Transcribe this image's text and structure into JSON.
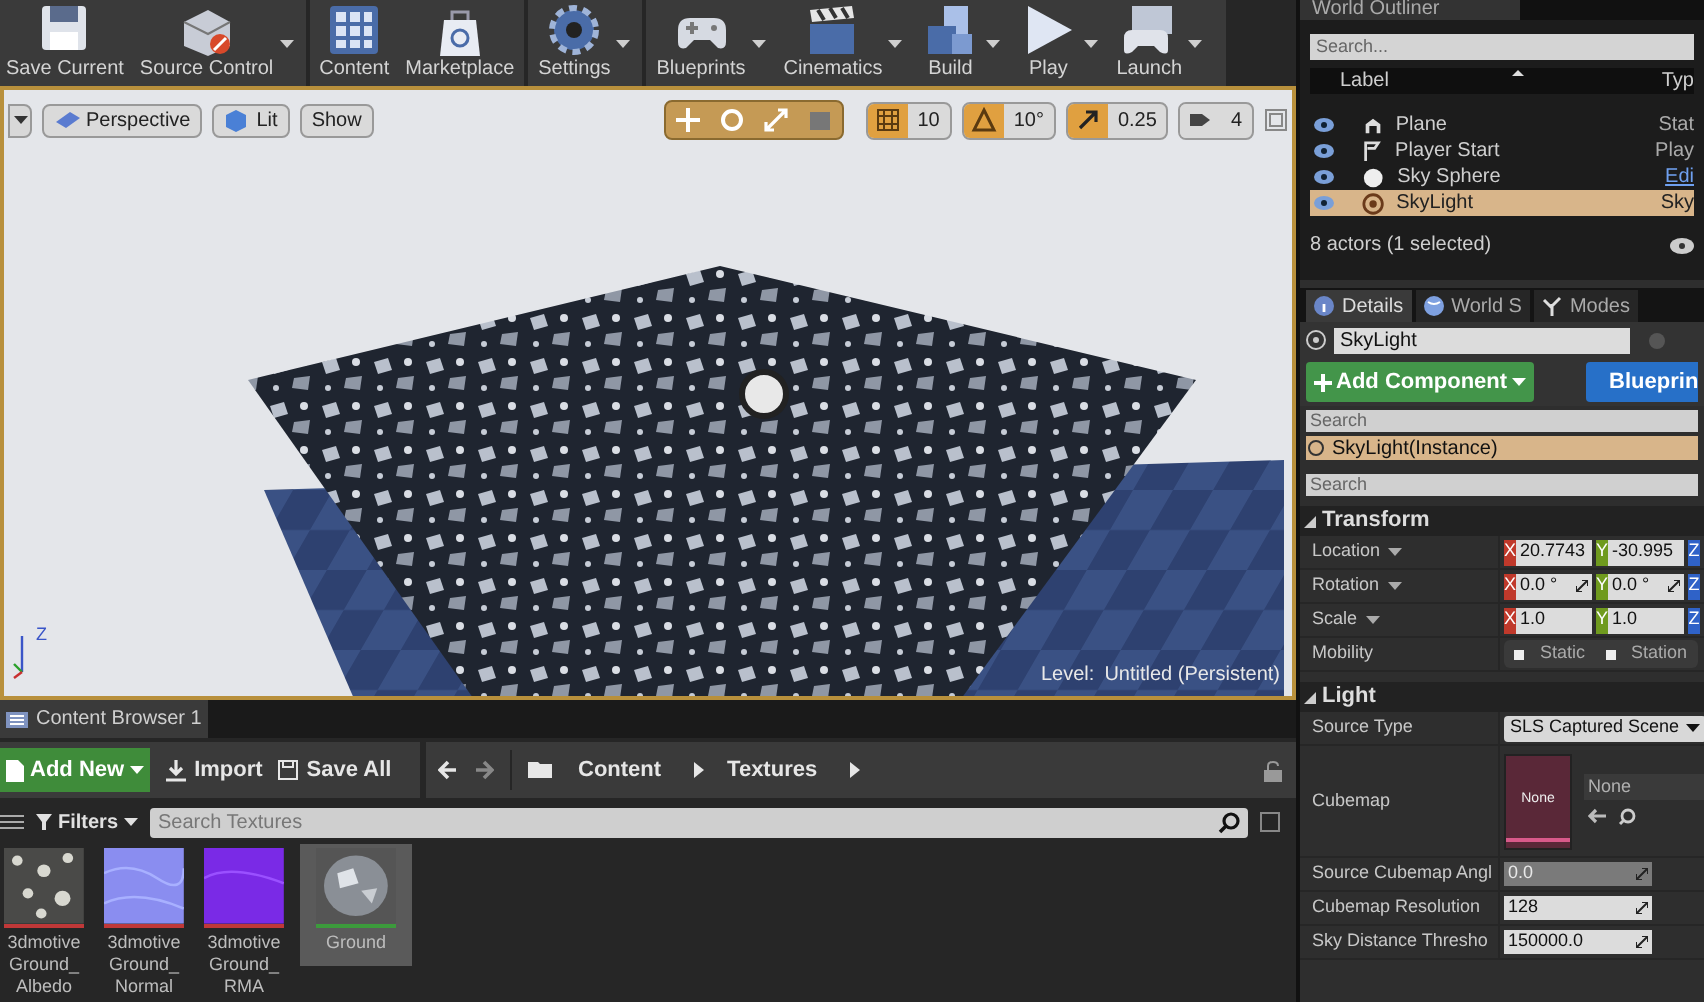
{
  "toolbar": {
    "buttons": [
      {
        "label": "Save Current",
        "dropdown": false
      },
      {
        "label": "Source Control",
        "dropdown": true
      },
      {
        "label": "Content",
        "dropdown": false
      },
      {
        "label": "Marketplace",
        "dropdown": false
      },
      {
        "label": "Settings",
        "dropdown": true
      },
      {
        "label": "Blueprints",
        "dropdown": true
      },
      {
        "label": "Cinematics",
        "dropdown": true
      },
      {
        "label": "Build",
        "dropdown": true
      },
      {
        "label": "Play",
        "dropdown": true
      },
      {
        "label": "Launch",
        "dropdown": true
      }
    ]
  },
  "viewport": {
    "view_buttons": [
      "Perspective",
      "Lit",
      "Show"
    ],
    "snaps": [
      {
        "value": "10",
        "active": true
      },
      {
        "value": "10°",
        "active": true
      },
      {
        "value": "0.25",
        "active": true
      },
      {
        "value": "4",
        "active": false
      }
    ],
    "axis_label": "Z",
    "level_label": "Level:",
    "level_name": "Untitled (Persistent)"
  },
  "world_outliner": {
    "title": "World Outliner",
    "search_placeholder": "Search...",
    "columns": [
      "Label",
      "Typ"
    ],
    "rows": [
      {
        "label": "Plane",
        "type": "Stat",
        "type_is_link": false,
        "visible": true,
        "selected": false
      },
      {
        "label": "Player Start",
        "type": "Play",
        "type_is_link": false,
        "visible": true,
        "selected": false
      },
      {
        "label": "Sky Sphere",
        "type": "Edi",
        "type_is_link": true,
        "visible": true,
        "selected": false
      },
      {
        "label": "SkyLight",
        "type": "Sky",
        "type_is_link": false,
        "visible": true,
        "selected": true
      }
    ],
    "status": "8 actors (1 selected)"
  },
  "details": {
    "tabs": [
      {
        "label": "Details",
        "selected": true
      },
      {
        "label": "World S",
        "selected": false
      },
      {
        "label": "Modes",
        "selected": false
      }
    ],
    "actor_name": "SkyLight",
    "add_component": "Add Component",
    "blueprint": "Blueprin",
    "component_search_placeholder": "Search",
    "components": [
      {
        "label": "SkyLight(Instance)",
        "selected": true
      }
    ],
    "property_search_placeholder": "Search",
    "sections": [
      {
        "title": "Transform",
        "expanded": true,
        "rows": [
          {
            "kind": "vector",
            "label": "Location",
            "fields": [
              {
                "axis": "X",
                "value": "20.7743"
              },
              {
                "axis": "Y",
                "value": "-30.995"
              },
              {
                "axis": "Z"
              }
            ]
          },
          {
            "kind": "vector",
            "label": "Rotation",
            "fields": [
              {
                "axis": "X",
                "value": "0.0 °"
              },
              {
                "axis": "Y",
                "value": "0.0 °"
              },
              {
                "axis": "Z"
              }
            ]
          },
          {
            "kind": "vector",
            "label": "Scale",
            "fields": [
              {
                "axis": "X",
                "value": "1.0"
              },
              {
                "axis": "Y",
                "value": "1.0"
              },
              {
                "axis": "Z"
              }
            ]
          },
          {
            "kind": "toggle",
            "label": "Mobility",
            "options": [
              {
                "label": "Static",
                "selected": false
              },
              {
                "label": "Station",
                "selected": false
              }
            ]
          }
        ]
      },
      {
        "title": "Light",
        "expanded": true,
        "rows": [
          {
            "kind": "dropdown",
            "label": "Source Type",
            "value": "SLS Captured Scene"
          },
          {
            "kind": "asset",
            "label": "Cubemap",
            "thumb_text": "None",
            "value": "None"
          },
          {
            "kind": "number",
            "label": "Source Cubemap Angl",
            "value": "0.0",
            "disabled": true
          },
          {
            "kind": "number",
            "label": "Cubemap Resolution",
            "value": "128",
            "disabled": false
          },
          {
            "kind": "number",
            "label": "Sky Distance Thresho",
            "value": "150000.0",
            "disabled": false
          }
        ]
      }
    ]
  },
  "content_browser": {
    "tab": "Content Browser 1",
    "add_new": "Add New",
    "import": "Import",
    "save_all": "Save All",
    "path": [
      "Content",
      "Textures"
    ],
    "filters": "Filters",
    "search_placeholder": "Search Textures",
    "assets": [
      {
        "name": "3dmotive Ground_ Albedo",
        "color": "#c03838",
        "selected": false
      },
      {
        "name": "3dmotive Ground_ Normal",
        "color": "#c03838",
        "selected": false
      },
      {
        "name": "3dmotive Ground_ RMA",
        "color": "#c03838",
        "selected": false
      },
      {
        "name": "Ground",
        "color": "#3c9a3c",
        "selected": true
      }
    ]
  }
}
